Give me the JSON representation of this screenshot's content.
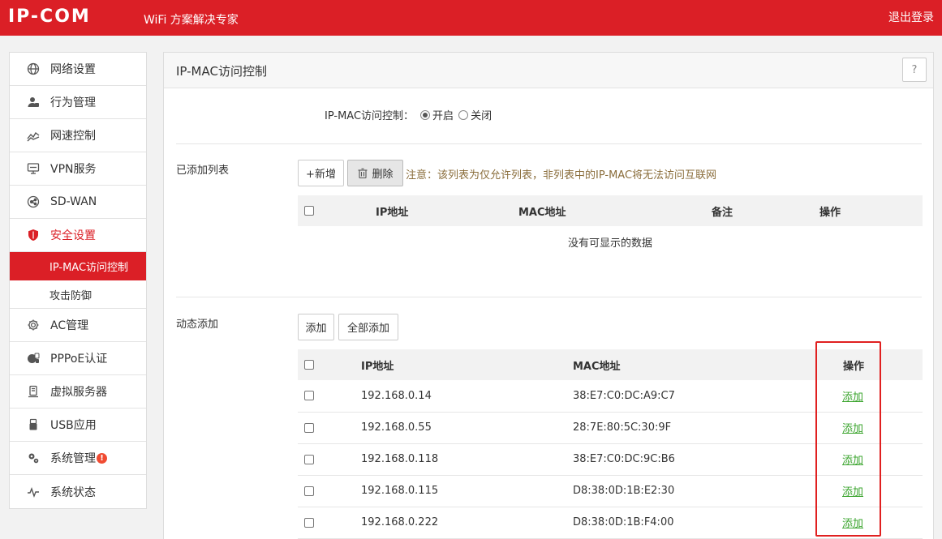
{
  "header": {
    "logo": "IP-COM",
    "slogan": "WiFi 方案解决专家",
    "logout": "退出登录"
  },
  "sidebar": {
    "items": [
      {
        "label": "网络设置",
        "icon": "globe-icon"
      },
      {
        "label": "行为管理",
        "icon": "user-manage-icon"
      },
      {
        "label": "网速控制",
        "icon": "speed-chart-icon"
      },
      {
        "label": "VPN服务",
        "icon": "monitor-icon"
      },
      {
        "label": "SD-WAN",
        "icon": "network-node-icon"
      },
      {
        "label": "安全设置",
        "icon": "shield-icon"
      },
      {
        "label": "AC管理",
        "icon": "gear-outline-icon"
      },
      {
        "label": "PPPoE认证",
        "icon": "pppoe-icon"
      },
      {
        "label": "虚拟服务器",
        "icon": "server-icon"
      },
      {
        "label": "USB应用",
        "icon": "usb-icon"
      },
      {
        "label": "系统管理",
        "icon": "gears-icon"
      },
      {
        "label": "系统状态",
        "icon": "pulse-icon"
      }
    ],
    "sub_items": [
      "IP-MAC访问控制",
      "攻击防御"
    ],
    "alert_badge": "!"
  },
  "panel": {
    "title": "IP-MAC访问控制",
    "help": "?",
    "toggle": {
      "label": "IP-MAC访问控制：",
      "on_label": "开启",
      "off_label": "关闭",
      "selected": "on"
    },
    "added": {
      "section_label": "已添加列表",
      "add_button": "+新增",
      "delete_button": "删除",
      "note": "注意：该列表为仅允许列表，非列表中的IP-MAC将无法访问互联网",
      "columns": [
        "IP地址",
        "MAC地址",
        "备注",
        "操作"
      ],
      "empty_text": "没有可显示的数据"
    },
    "dynamic": {
      "section_label": "动态添加",
      "add_button": "添加",
      "add_all_button": "全部添加",
      "columns": [
        "IP地址",
        "MAC地址",
        "操作"
      ],
      "rows": [
        {
          "ip": "192.168.0.14",
          "mac": "38:E7:C0:DC:A9:C7",
          "action": "添加"
        },
        {
          "ip": "192.168.0.55",
          "mac": "28:7E:80:5C:30:9F",
          "action": "添加"
        },
        {
          "ip": "192.168.0.118",
          "mac": "38:E7:C0:DC:9C:B6",
          "action": "添加"
        },
        {
          "ip": "192.168.0.115",
          "mac": "D8:38:0D:1B:E2:30",
          "action": "添加"
        },
        {
          "ip": "192.168.0.222",
          "mac": "D8:38:0D:1B:F4:00",
          "action": "添加"
        }
      ]
    }
  },
  "colors": {
    "brand_red": "#db1f26",
    "link_green": "#3aa42d",
    "note_brown": "#8a6d3b"
  }
}
